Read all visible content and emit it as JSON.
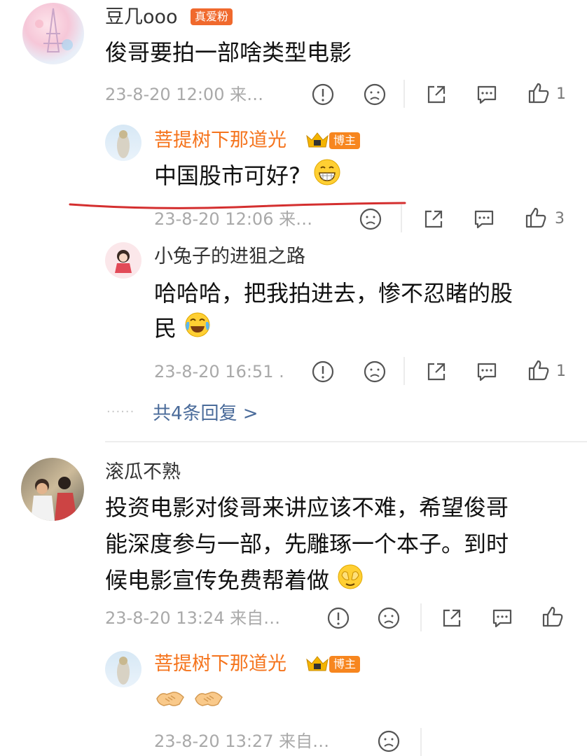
{
  "comments": [
    {
      "user": "豆几ooo",
      "badge": "真爱粉",
      "text": "俊哥要拍一部啥类型电影",
      "meta": "23-8-20 12:00 来…",
      "likes": "1",
      "replies": [
        {
          "user": "菩提树下那道光",
          "badge": "博主",
          "text": "中国股市可好?",
          "meta": "23-8-20 12:06 来…",
          "likes": "3"
        },
        {
          "user": "小兔子的进狙之路",
          "text_line1": "哈哈哈，把我拍进去，惨不忍睹的股",
          "text_line2": "民",
          "meta": "23-8-20 16:51 .",
          "likes": "1"
        }
      ],
      "more_replies": "共4条回复 >"
    },
    {
      "user": "滚瓜不熟",
      "text_line1": "投资电影对俊哥来讲应该不难，希望俊哥",
      "text_line2": "能深度参与一部，先雕琢一个本子。到时",
      "text_line3": "候电影宣传免费帮着做",
      "meta": "23-8-20 13:24 来自…",
      "replies": [
        {
          "user": "菩提树下那道光",
          "badge": "博主",
          "meta": "23-8-20 13:27 来自…"
        }
      ]
    }
  ],
  "colors": {
    "blogger_name": "#f5741d",
    "badge": "#f7861f",
    "annotation_line": "#d42f2f",
    "more_link": "#4a6b9a"
  },
  "icons": [
    "report-icon",
    "dislike-icon",
    "share-icon",
    "comment-icon",
    "like-icon",
    "grin-emoji",
    "laugh-cry-emoji",
    "facepalm-emoji",
    "handshake-emoji"
  ]
}
